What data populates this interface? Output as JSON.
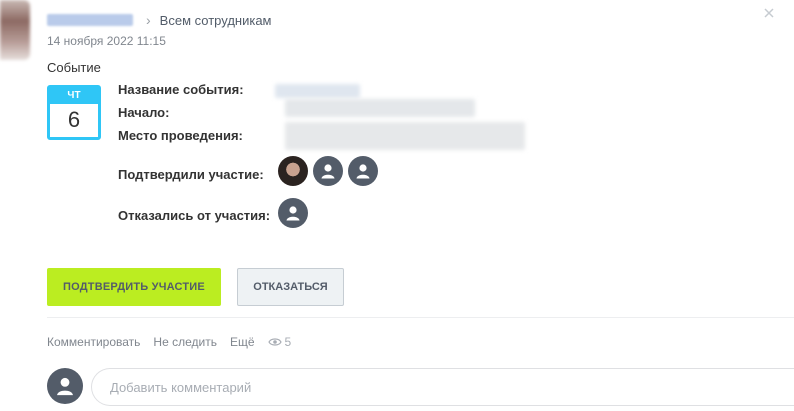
{
  "header": {
    "audience": "Всем сотрудникам",
    "separator": "›",
    "timestamp": "14 ноября 2022 11:15"
  },
  "event": {
    "section_title": "Событие",
    "calendar": {
      "weekday": "ЧТ",
      "day": "6",
      "accent_color": "#2fc6f6"
    },
    "fields": {
      "name_label": "Название события:",
      "start_label": "Начало:",
      "place_label": "Место проведения:"
    },
    "confirmed_label": "Подтвердили участие:",
    "declined_label": "Отказались от участия:"
  },
  "buttons": {
    "confirm": "ПОДТВЕРДИТЬ УЧАСТИЕ",
    "decline": "ОТКАЗАТЬСЯ",
    "confirm_color": "#bbed21"
  },
  "actions": {
    "comment": "Комментировать",
    "unfollow": "Не следить",
    "more": "Ещё",
    "views": "5"
  },
  "comment": {
    "placeholder": "Добавить комментарий"
  }
}
